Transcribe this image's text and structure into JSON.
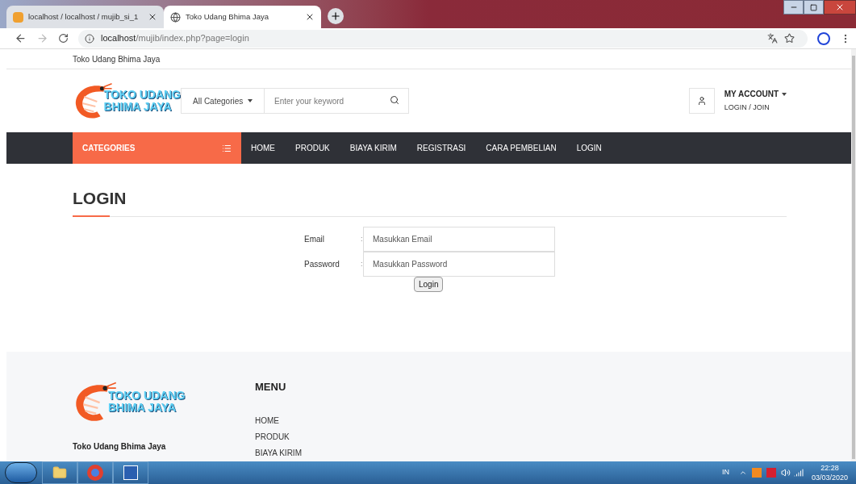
{
  "browser": {
    "tabs": [
      {
        "title": "localhost / localhost / mujib_si_1",
        "selected": false
      },
      {
        "title": "Toko Udang Bhima Jaya",
        "selected": true
      }
    ],
    "url": {
      "host": "localhost",
      "path": "/mujib/index.php?page=login"
    }
  },
  "topbar": {
    "text": "Toko Udang Bhima Jaya"
  },
  "header": {
    "logo": [
      "TOKO UDANG",
      "BHIMA JAYA"
    ],
    "category_select": "All Categories",
    "search": {
      "placeholder": "Enter your keyword"
    },
    "account": {
      "title": "MY ACCOUNT",
      "link": "LOGIN / JOIN"
    }
  },
  "nav": {
    "categories": "CATEGORIES",
    "items": [
      "HOME",
      "PRODUK",
      "BIAYA KIRIM",
      "REGISTRASI",
      "CARA PEMBELIAN",
      "LOGIN"
    ]
  },
  "login": {
    "title": "LOGIN",
    "fields": [
      {
        "label": "Email",
        "separator": ":",
        "placeholder": "Masukkan Email"
      },
      {
        "label": "Password",
        "separator": ":",
        "placeholder": "Masukkan Password"
      }
    ],
    "button": "Login"
  },
  "footer": {
    "logo": [
      "TOKO UDANG",
      "BHIMA JAYA"
    ],
    "name": "Toko Udang Bhima Jaya",
    "menu_title": "MENU",
    "menu": [
      "HOME",
      "PRODUK",
      "BIAYA KIRIM"
    ]
  },
  "taskbar": {
    "language": "IN",
    "time": "22:28",
    "date": "03/03/2020"
  }
}
